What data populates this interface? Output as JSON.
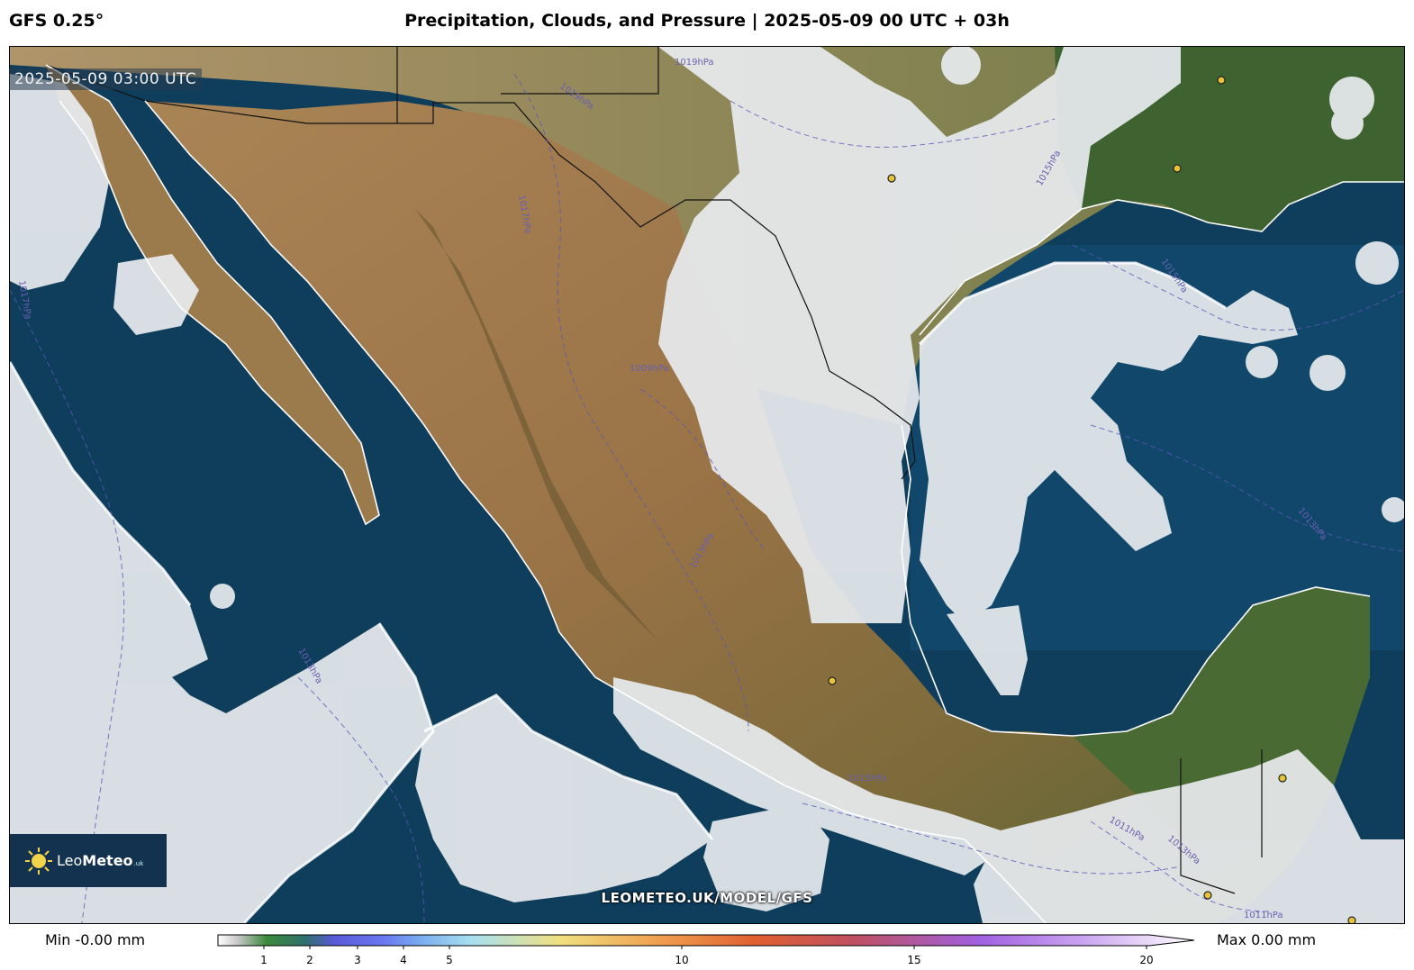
{
  "header": {
    "model": "GFS 0.25°",
    "title": "Precipitation, Clouds, and Pressure | 2025-05-09 00 UTC + 03h"
  },
  "map": {
    "timestamp": "2025-05-09 03:00 UTC",
    "watermark": "LEOMETEO.UK/MODEL/GFS",
    "pressure_labels": [
      "1019hPa",
      "1019hPa",
      "1017hPa",
      "1015hPa",
      "1015hPa",
      "1017hPa",
      "1009hPa",
      "1013hPa",
      "1013hPa",
      "1013hPa",
      "1015hPa",
      "1011hPa",
      "1011hPa",
      "1013hPa"
    ],
    "colors": {
      "ocean": "#0f3d5c",
      "land_dry": "#a07a4a",
      "land_green": "#3d5e2e",
      "cloud": "#e6eaec"
    }
  },
  "logo": {
    "name_light": "Leo",
    "name_bold": "Meteo",
    "suffix": ".uk"
  },
  "colorbar": {
    "min_label": "Min -0.00 mm",
    "max_label": "Max 0.00 mm",
    "ticks": [
      "1",
      "2",
      "3",
      "4",
      "5",
      "10",
      "15",
      "20"
    ]
  }
}
